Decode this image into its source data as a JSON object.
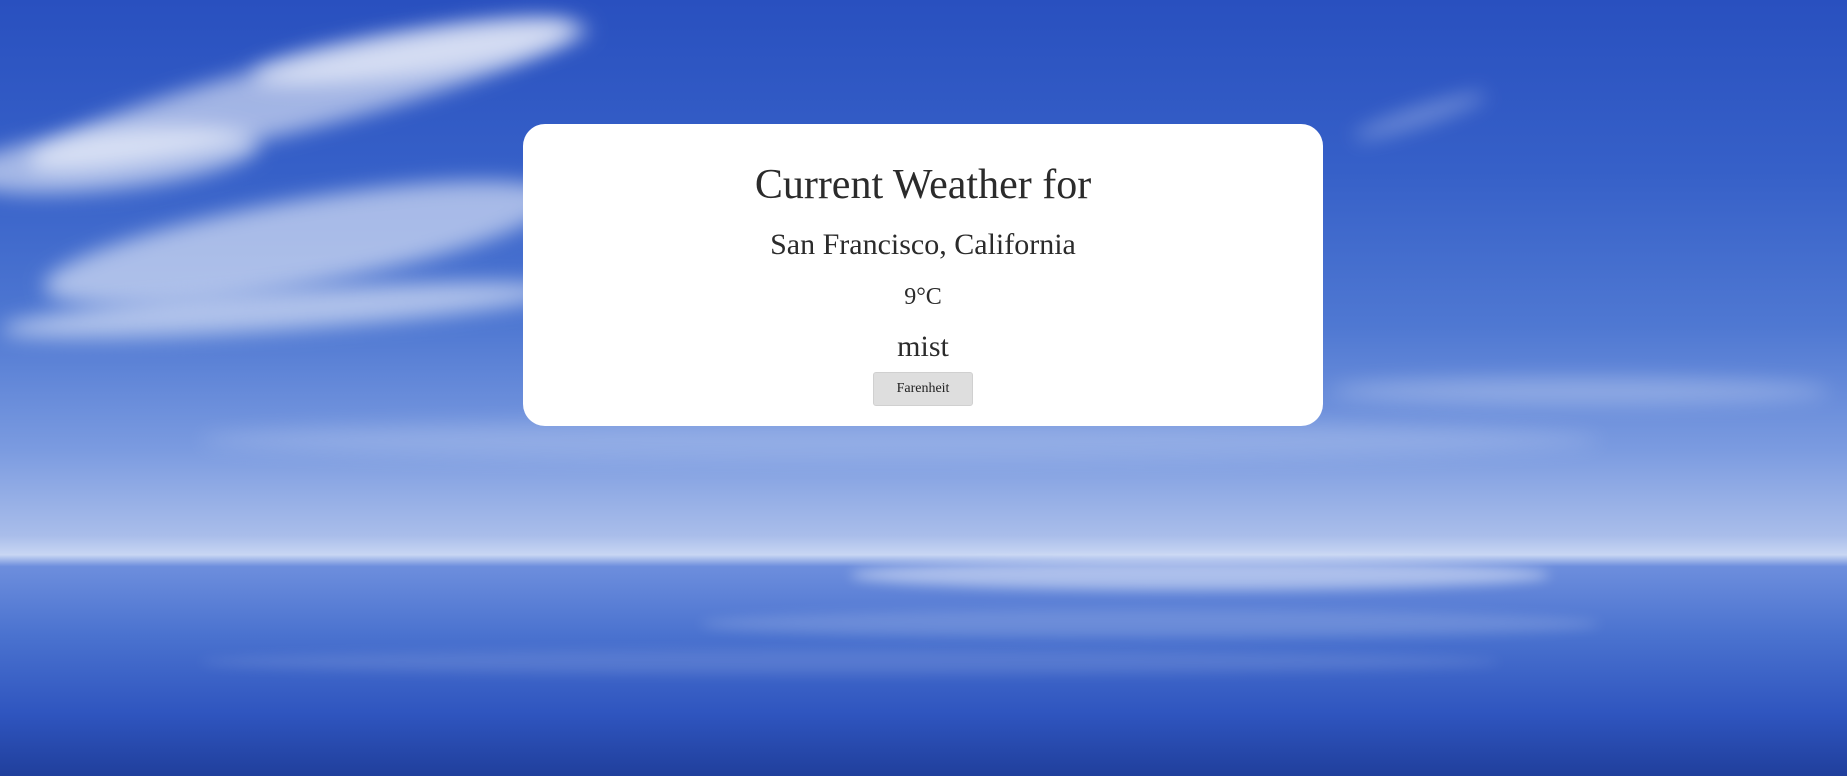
{
  "weather": {
    "title": "Current Weather for",
    "location": "San Francisco, California",
    "temperature": "9°C",
    "description": "mist",
    "unit_toggle_label": "Farenheit"
  },
  "colors": {
    "sky_top": "#2950bf",
    "horizon": "#c8d6f3",
    "sea_bottom": "#203f9c",
    "card_background": "#ffffff",
    "button_background": "#dedede"
  }
}
